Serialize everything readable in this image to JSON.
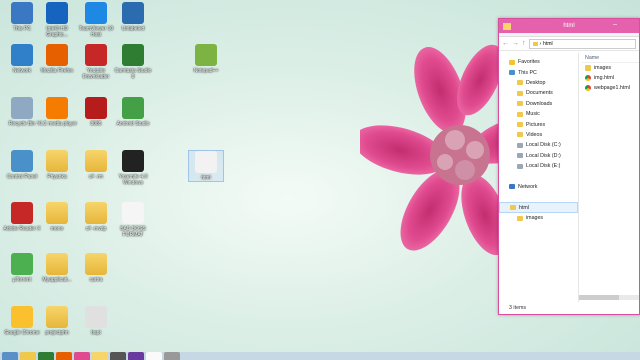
{
  "desktop": {
    "icons": [
      {
        "label": "This PC",
        "glyph": "computer-icon",
        "color": "#3a78c4"
      },
      {
        "label": "Intel® HD Graphic...",
        "glyph": "intel-graphics-icon",
        "color": "#1565c0"
      },
      {
        "label": "TeamViewer 10 Host",
        "glyph": "teamviewer-icon",
        "color": "#1e88e5"
      },
      {
        "label": "Unlabeled",
        "glyph": "blue-app-icon",
        "color": "#2b6cb0"
      },
      {
        "label": "Network",
        "glyph": "network-icon",
        "color": "#2f7fc9"
      },
      {
        "label": "Mozilla Firefox",
        "glyph": "firefox-icon",
        "color": "#e66000"
      },
      {
        "label": "Youtube Downloader",
        "glyph": "youtube-downloader-icon",
        "color": "#c62828"
      },
      {
        "label": "Camtasia Studio 8",
        "glyph": "camtasia-icon",
        "color": "#2e7d32"
      },
      {
        "label": "Notepad++",
        "glyph": "notepad-plus-icon",
        "color": "#7cb342"
      },
      {
        "label": "Recycle Bin",
        "glyph": "recycle-bin-icon",
        "color": "#8fa9c2"
      },
      {
        "label": "VLC media player",
        "glyph": "vlc-icon",
        "color": "#f57c00"
      },
      {
        "label": "8085",
        "glyph": "8085-icon",
        "color": "#b71c1c"
      },
      {
        "label": "Android Studio",
        "glyph": "android-studio-icon",
        "color": "#43a047"
      },
      {
        "label": "Control Panel",
        "glyph": "control-panel-icon",
        "color": "#4a90c9"
      },
      {
        "label": "Priyanka",
        "glyph": "folder-icon",
        "color": "#f0c84c"
      },
      {
        "label": "c# -rm",
        "glyph": "folder-icon",
        "color": "#f0c84c"
      },
      {
        "label": "Yosemite 4.0 Windows",
        "glyph": "apple-icon",
        "color": "#222222"
      },
      {
        "label": "html",
        "glyph": "chrome-html-icon",
        "color": "#f2f2f2"
      },
      {
        "label": "Adobe Reader X",
        "glyph": "adobe-reader-icon",
        "color": "#c62828"
      },
      {
        "label": "mono",
        "glyph": "folder-icon",
        "color": "#f0c84c"
      },
      {
        "label": "c# -mvdp",
        "glyph": "folder-icon",
        "color": "#f0c84c"
      },
      {
        "label": "BAD BOSS FORMAT",
        "glyph": "document-icon",
        "color": "#f5f5f5"
      },
      {
        "label": "µTorrent",
        "glyph": "utorrent-icon",
        "color": "#4caf50"
      },
      {
        "label": "Myapplicati...",
        "glyph": "folder-icon",
        "color": "#f0c84c"
      },
      {
        "label": "cartra",
        "glyph": "folder-icon",
        "color": "#f0c84c"
      },
      {
        "label": "Google Chrome",
        "glyph": "chrome-icon",
        "color": "#fbc02d"
      },
      {
        "label": "projectphn",
        "glyph": "folder-icon",
        "color": "#f0c84c"
      },
      {
        "label": "bapt",
        "glyph": "file-icon",
        "color": "#e0e0e0"
      }
    ]
  },
  "explorer": {
    "title": "html",
    "address": "html",
    "nav": [
      {
        "label": "Favorites",
        "icon": "star-icon",
        "indent": 0
      },
      {
        "label": "This PC",
        "icon": "computer-icon",
        "indent": 0
      },
      {
        "label": "Desktop",
        "icon": "folder-icon",
        "indent": 1
      },
      {
        "label": "Documents",
        "icon": "folder-icon",
        "indent": 1
      },
      {
        "label": "Downloads",
        "icon": "folder-icon",
        "indent": 1
      },
      {
        "label": "Music",
        "icon": "folder-icon",
        "indent": 1
      },
      {
        "label": "Pictures",
        "icon": "folder-icon",
        "indent": 1
      },
      {
        "label": "Videos",
        "icon": "folder-icon",
        "indent": 1
      },
      {
        "label": "Local Disk (C:)",
        "icon": "disk-icon",
        "indent": 1
      },
      {
        "label": "Local Disk (D:)",
        "icon": "disk-icon",
        "indent": 1
      },
      {
        "label": "Local Disk (E:)",
        "icon": "disk-icon",
        "indent": 1
      },
      {
        "label": "",
        "icon": "",
        "indent": 0
      },
      {
        "label": "Network",
        "icon": "network-icon",
        "indent": 0
      },
      {
        "label": "",
        "icon": "",
        "indent": 0
      },
      {
        "label": "html",
        "icon": "folder-icon",
        "indent": 0,
        "selected": true
      },
      {
        "label": "images",
        "icon": "folder-icon",
        "indent": 1
      }
    ],
    "column_header": "Name",
    "files": [
      {
        "name": "images",
        "icon": "folder-icon"
      },
      {
        "name": "img.html",
        "icon": "chrome-icon"
      },
      {
        "name": "webpage1.html",
        "icon": "chrome-icon"
      }
    ],
    "status": "3 items"
  },
  "colors": {
    "accent": "#e561ad",
    "flower": "#e04a8e"
  }
}
